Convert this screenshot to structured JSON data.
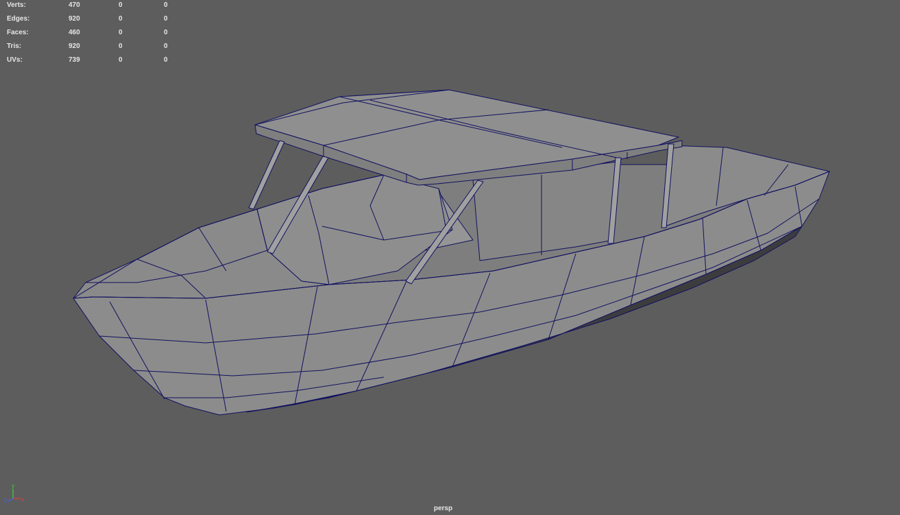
{
  "stats": [
    {
      "label": "Verts:",
      "values": [
        "470",
        "0",
        "0"
      ]
    },
    {
      "label": "Edges:",
      "values": [
        "920",
        "0",
        "0"
      ]
    },
    {
      "label": "Faces:",
      "values": [
        "460",
        "0",
        "0"
      ]
    },
    {
      "label": "Tris:",
      "values": [
        "920",
        "0",
        "0"
      ]
    },
    {
      "label": "UVs:",
      "values": [
        "739",
        "0",
        "0"
      ]
    }
  ],
  "camera": "persp",
  "axis": {
    "x": "x",
    "y": "y",
    "z": "z"
  },
  "colors": {
    "background": "#5d5d5d",
    "mesh_face": "#8a8a8a",
    "mesh_face_light": "#979797",
    "mesh_face_dark": "#7a7a7a",
    "mesh_bottom": "#3c3c3f",
    "wireframe": "#101060",
    "axis_x": "#e04040",
    "axis_y": "#40d040",
    "axis_z": "#4060ff"
  }
}
